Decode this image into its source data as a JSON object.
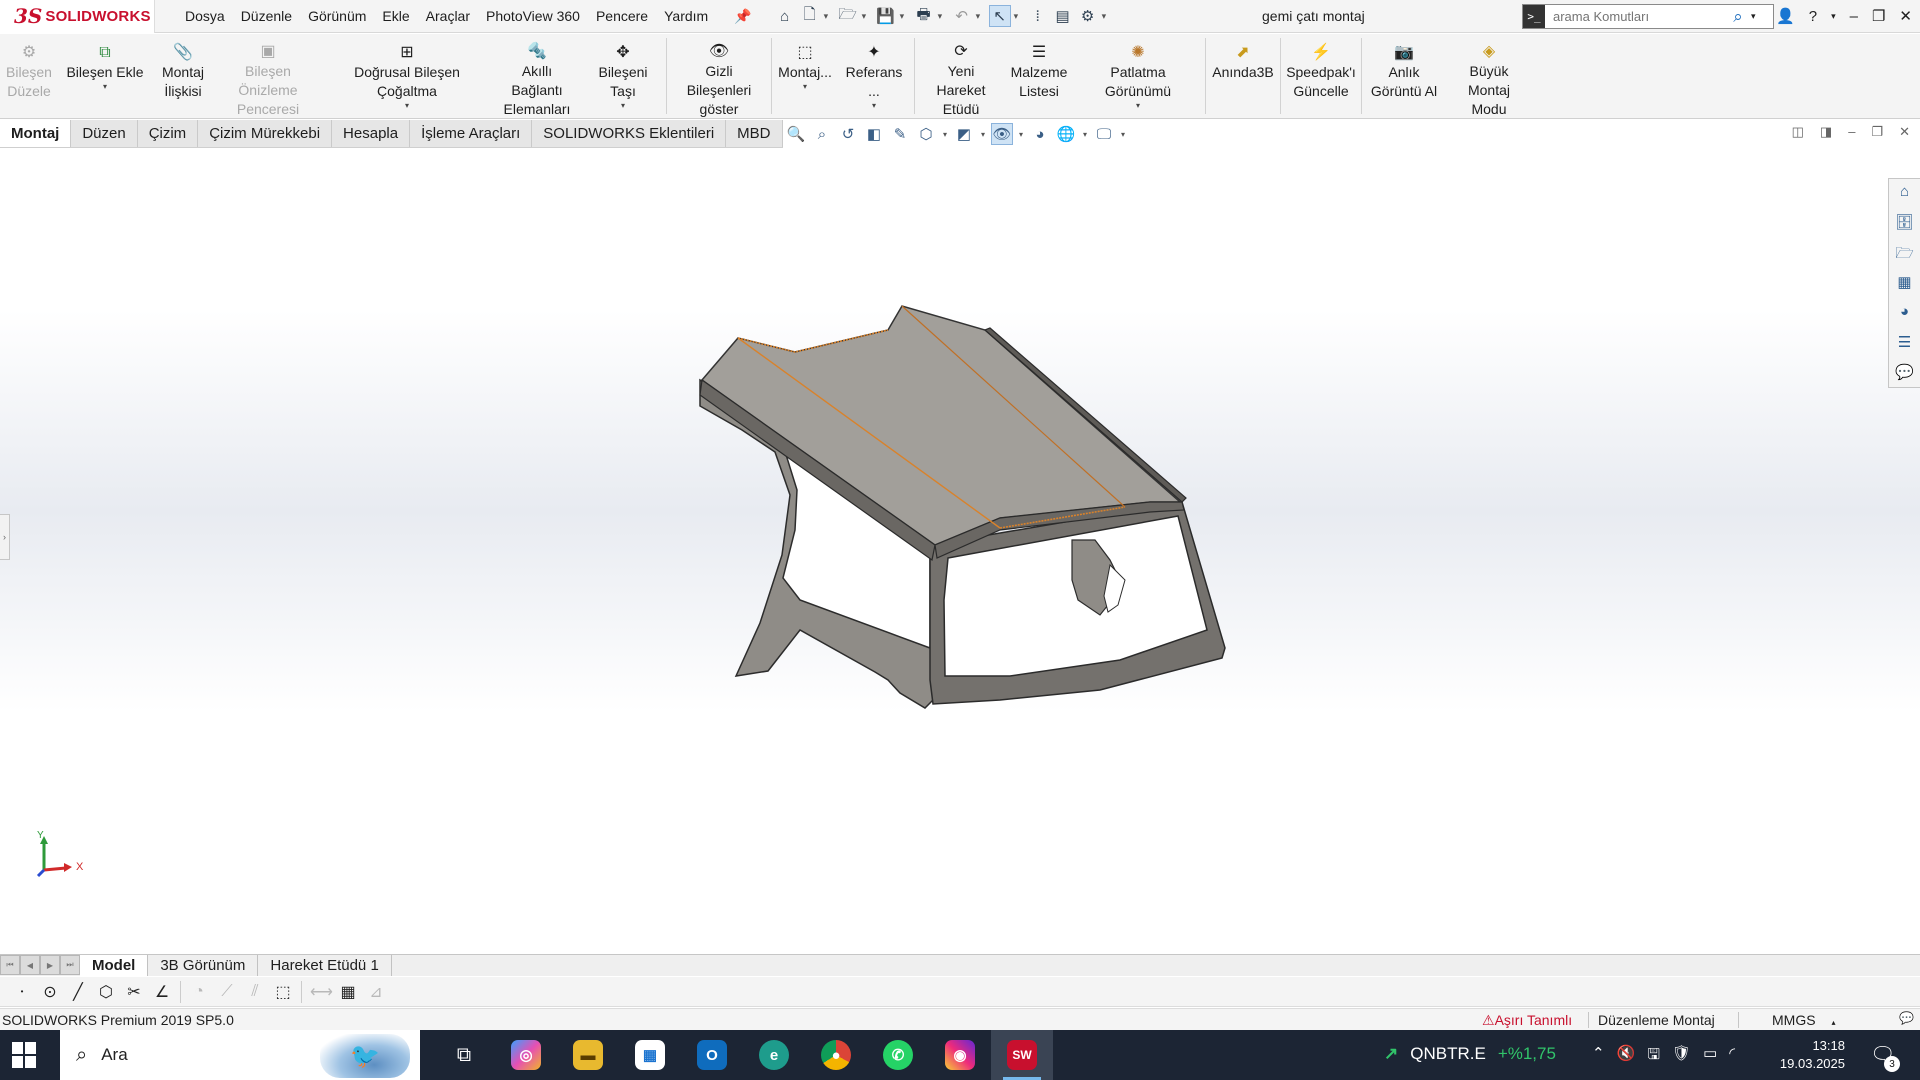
{
  "app": {
    "logo_ds": "3S",
    "logo_brand": "SOLIDWORKS",
    "document_title": "gemi çatı montaj"
  },
  "menus": [
    "Dosya",
    "Düzenle",
    "Görünüm",
    "Ekle",
    "Araçlar",
    "PhotoView 360",
    "Pencere",
    "Yardım"
  ],
  "search": {
    "placeholder": "arama Komutları"
  },
  "commands": [
    {
      "label": "Bileşen Düzele",
      "lines": [
        "Bileşen",
        "Düzele"
      ],
      "icon": "⚙",
      "disabled": true
    },
    {
      "label": "Bileşen Ekle",
      "lines": [
        "Bileşen Ekle"
      ],
      "icon": "⧉",
      "disabled": false
    },
    {
      "label": "Montaj İlişkisi",
      "lines": [
        "Montaj",
        "İlişkisi"
      ],
      "icon": "📎",
      "disabled": false
    },
    {
      "label": "Bileşen Önizleme Penceresi",
      "lines": [
        "Bileşen Önizleme",
        "Penceresi"
      ],
      "icon": "▣",
      "disabled": true
    },
    {
      "label": "Doğrusal Bileşen Çoğaltma",
      "lines": [
        "Doğrusal Bileşen Çoğaltma"
      ],
      "icon": "⊞",
      "disabled": false
    },
    {
      "label": "Akıllı Bağlantı Elemanları",
      "lines": [
        "Akıllı Bağlantı",
        "Elemanları"
      ],
      "icon": "🔩",
      "disabled": false
    },
    {
      "label": "Bileşeni Taşı",
      "lines": [
        "Bileşeni Taşı"
      ],
      "icon": "✥",
      "disabled": false
    },
    {
      "label": "Gizli Bileşenleri göster",
      "lines": [
        "Gizli Bileşenleri",
        "göster"
      ],
      "icon": "👁",
      "disabled": false
    },
    {
      "label": "Montaj...",
      "lines": [
        "Montaj..."
      ],
      "icon": "⬚",
      "disabled": false
    },
    {
      "label": "Referans ...",
      "lines": [
        "Referans ..."
      ],
      "icon": "✦",
      "disabled": false
    },
    {
      "label": "Yeni Hareket Etüdü",
      "lines": [
        "Yeni Hareket",
        "Etüdü"
      ],
      "icon": "⟳",
      "disabled": false
    },
    {
      "label": "Malzeme Listesi",
      "lines": [
        "Malzeme",
        "Listesi"
      ],
      "icon": "☰",
      "disabled": false
    },
    {
      "label": "Patlatma Görünümü",
      "lines": [
        "Patlatma Görünümü"
      ],
      "icon": "✺",
      "disabled": false
    },
    {
      "label": "Anında3B",
      "lines": [
        "Anında3B"
      ],
      "icon": "⬈",
      "disabled": false
    },
    {
      "label": "Speedpak'ı Güncelle",
      "lines": [
        "Speedpak'ı",
        "Güncelle"
      ],
      "icon": "⚡",
      "disabled": false
    },
    {
      "label": "Anlık Görüntü Al",
      "lines": [
        "Anlık",
        "Görüntü Al"
      ],
      "icon": "📷",
      "disabled": false
    },
    {
      "label": "Büyük Montaj Modu",
      "lines": [
        "Büyük",
        "Montaj Modu"
      ],
      "icon": "◈",
      "disabled": false
    }
  ],
  "tabs": [
    "Montaj",
    "Düzen",
    "Çizim",
    "Çizim Mürekkebi",
    "Hesapla",
    "İşleme Araçları",
    "SOLIDWORKS Eklentileri",
    "MBD"
  ],
  "active_tab": "Montaj",
  "triad": {
    "y": "Y",
    "x": "X"
  },
  "bottom_tabs": [
    "Model",
    "3B Görünüm",
    "Hareket Etüdü 1"
  ],
  "active_bottom_tab": "Model",
  "status": {
    "version": "SOLIDWORKS Premium 2019 SP5.0",
    "definition": "Aşırı Tanımlı",
    "mode": "Düzenleme Montaj",
    "units": "MMGS"
  },
  "taskbar": {
    "search_label": "Ara",
    "stock_symbol": "QNBTR.E",
    "stock_change": "+%1,75",
    "time": "13:18",
    "date": "19.03.2025",
    "notifications": "3"
  },
  "colors": {
    "brand": "#c8102e",
    "accent": "#1f6fbf",
    "model_face": "#a29f9a",
    "model_edge": "#3a3a3a",
    "selection_edge": "#d9822b"
  }
}
